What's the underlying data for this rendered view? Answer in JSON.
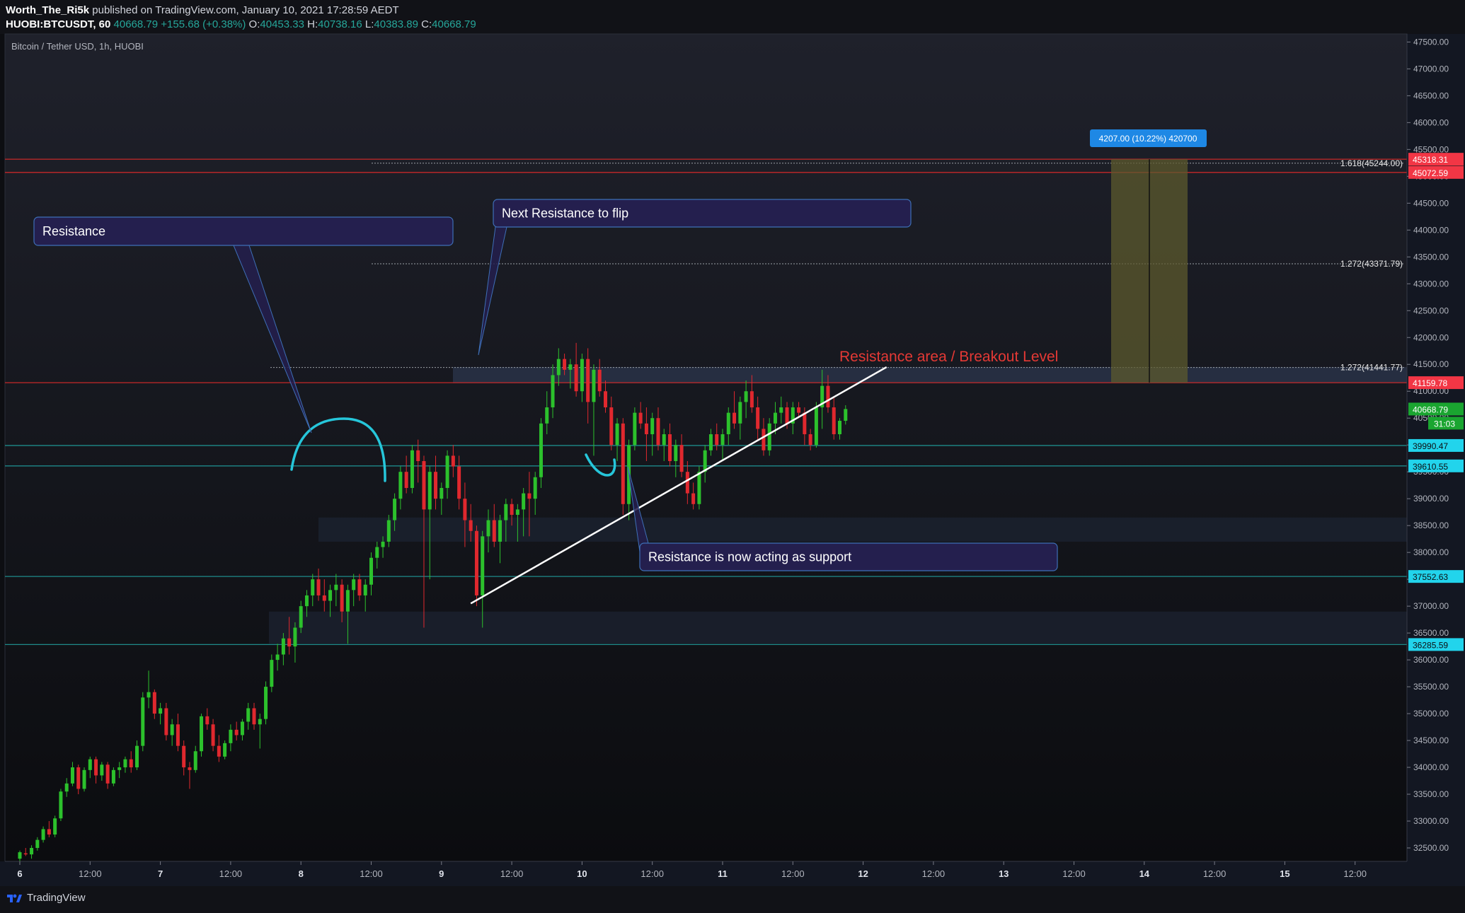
{
  "header": {
    "author": "Worth_The_Ri5k",
    "published": "published on TradingView.com, January 10, 2021 17:28:59 AEDT",
    "symbol": "HUOBI:BTCUSDT, 60",
    "last": "40668.79",
    "change": "+155.68 (+0.38%)",
    "open_label": "O:",
    "open": "40453.33",
    "high_label": "H:",
    "high": "40738.16",
    "low_label": "L:",
    "low": "40383.89",
    "close_label": "C:",
    "close": "40668.79"
  },
  "legend_title": "Bitcoin / Tether USD, 1h, HUOBI",
  "footer": {
    "brand": "TradingView"
  },
  "colors": {
    "up": "#26a69a",
    "up_body": "#2cc12c",
    "down": "#e0282e",
    "red_line": "#b71c1c",
    "cyan": "#26c6da",
    "teal_line": "#1e8a8a",
    "callout_bg": "#241f4e",
    "callout_border": "#3e6fb7",
    "projection_fill": "#5c5a2d",
    "price_green": "#1aa530",
    "price_red": "#f23645"
  },
  "chart_data": {
    "type": "candlestick",
    "title": "Bitcoin / Tether USD, 1h, HUOBI",
    "ylim": [
      32250,
      47650
    ],
    "y_ticks": [
      "32500.00",
      "33000.00",
      "33500.00",
      "34000.00",
      "34500.00",
      "35000.00",
      "35500.00",
      "36000.00",
      "36500.00",
      "37000.00",
      "37500.00",
      "38000.00",
      "38500.00",
      "39000.00",
      "39500.00",
      "40000.00",
      "40500.00",
      "41000.00",
      "41500.00",
      "42000.00",
      "42500.00",
      "43000.00",
      "43500.00",
      "44000.00",
      "44500.00",
      "45000.00",
      "45500.00",
      "46000.00",
      "46500.00",
      "47000.00",
      "47500.00"
    ],
    "x_ticks": [
      "6",
      "12:00",
      "7",
      "12:00",
      "8",
      "12:00",
      "9",
      "12:00",
      "10",
      "12:00",
      "11",
      "12:00",
      "12",
      "12:00",
      "13",
      "12:00",
      "14",
      "12:00",
      "15",
      "12:00"
    ],
    "candles": [
      [
        32300,
        32450,
        32250,
        32420
      ],
      [
        32400,
        32500,
        32350,
        32380
      ],
      [
        32380,
        32550,
        32300,
        32500
      ],
      [
        32500,
        32700,
        32450,
        32650
      ],
      [
        32650,
        32900,
        32600,
        32850
      ],
      [
        32850,
        33000,
        32700,
        32750
      ],
      [
        32750,
        33100,
        32700,
        33050
      ],
      [
        33050,
        33600,
        33000,
        33550
      ],
      [
        33550,
        33800,
        33450,
        33700
      ],
      [
        33700,
        34100,
        33650,
        34000
      ],
      [
        34000,
        34050,
        33500,
        33600
      ],
      [
        33600,
        34000,
        33550,
        33950
      ],
      [
        33950,
        34200,
        33800,
        34150
      ],
      [
        34150,
        34200,
        33700,
        33850
      ],
      [
        33850,
        34100,
        33750,
        34050
      ],
      [
        34050,
        34100,
        33600,
        33700
      ],
      [
        33700,
        34000,
        33650,
        33950
      ],
      [
        33950,
        34100,
        33800,
        34000
      ],
      [
        34000,
        34200,
        33900,
        34150
      ],
      [
        34150,
        34300,
        33900,
        34000
      ],
      [
        34000,
        34500,
        33950,
        34400
      ],
      [
        34400,
        35400,
        34300,
        35300
      ],
      [
        35300,
        35800,
        35100,
        35400
      ],
      [
        35400,
        35450,
        34900,
        35000
      ],
      [
        35000,
        35200,
        34800,
        35100
      ],
      [
        35100,
        35200,
        34500,
        34600
      ],
      [
        34600,
        34900,
        34400,
        34800
      ],
      [
        34800,
        35000,
        34300,
        34400
      ],
      [
        34400,
        34500,
        33850,
        34000
      ],
      [
        34000,
        34100,
        33600,
        33950
      ],
      [
        33950,
        34400,
        33900,
        34300
      ],
      [
        34300,
        35000,
        34200,
        34950
      ],
      [
        34950,
        35100,
        34700,
        34800
      ],
      [
        34800,
        34900,
        34300,
        34400
      ],
      [
        34400,
        34600,
        34100,
        34200
      ],
      [
        34200,
        34500,
        34150,
        34450
      ],
      [
        34450,
        34800,
        34300,
        34700
      ],
      [
        34700,
        34850,
        34500,
        34600
      ],
      [
        34600,
        34900,
        34500,
        34850
      ],
      [
        34850,
        35200,
        34700,
        35100
      ],
      [
        35100,
        35200,
        34700,
        34800
      ],
      [
        34800,
        35000,
        34350,
        34900
      ],
      [
        34900,
        35600,
        34800,
        35500
      ],
      [
        35500,
        36100,
        35400,
        36000
      ],
      [
        36000,
        36300,
        35800,
        36100
      ],
      [
        36100,
        36500,
        35900,
        36400
      ],
      [
        36400,
        36800,
        36100,
        36250
      ],
      [
        36250,
        36700,
        35950,
        36600
      ],
      [
        36600,
        37100,
        36500,
        37000
      ],
      [
        37000,
        37300,
        36800,
        37200
      ],
      [
        37200,
        37600,
        37000,
        37500
      ],
      [
        37500,
        37700,
        37100,
        37200
      ],
      [
        37200,
        37500,
        36900,
        37100
      ],
      [
        37100,
        37400,
        36800,
        37300
      ],
      [
        37300,
        37600,
        37000,
        37400
      ],
      [
        37400,
        37500,
        36700,
        36900
      ],
      [
        36900,
        37400,
        36300,
        37300
      ],
      [
        37300,
        37600,
        37000,
        37500
      ],
      [
        37500,
        37600,
        37100,
        37200
      ],
      [
        37200,
        37500,
        36900,
        37400
      ],
      [
        37400,
        38000,
        37200,
        37900
      ],
      [
        37900,
        38200,
        37700,
        38100
      ],
      [
        38100,
        38300,
        37900,
        38200
      ],
      [
        38200,
        38700,
        38100,
        38600
      ],
      [
        38600,
        39100,
        38400,
        39000
      ],
      [
        39000,
        39600,
        38800,
        39500
      ],
      [
        39500,
        39800,
        39100,
        39200
      ],
      [
        39200,
        40000,
        39100,
        39900
      ],
      [
        39900,
        40100,
        39300,
        39700
      ],
      [
        39700,
        39800,
        36600,
        38800
      ],
      [
        38800,
        39600,
        37500,
        39500
      ],
      [
        39500,
        39800,
        38800,
        39000
      ],
      [
        39000,
        39300,
        38700,
        39200
      ],
      [
        39200,
        39900,
        39000,
        39800
      ],
      [
        39800,
        40000,
        39400,
        39600
      ],
      [
        39600,
        39800,
        38800,
        39000
      ],
      [
        39000,
        39300,
        38100,
        38600
      ],
      [
        38600,
        38900,
        38200,
        38400
      ],
      [
        38400,
        38500,
        37000,
        37200
      ],
      [
        37200,
        38400,
        36600,
        38300
      ],
      [
        38300,
        38800,
        38000,
        38600
      ],
      [
        38600,
        38900,
        38100,
        38200
      ],
      [
        38200,
        38700,
        37800,
        38600
      ],
      [
        38600,
        39000,
        38200,
        38900
      ],
      [
        38900,
        39000,
        38500,
        38700
      ],
      [
        38700,
        38900,
        38200,
        38800
      ],
      [
        38800,
        39200,
        38300,
        39100
      ],
      [
        39100,
        39500,
        38300,
        39000
      ],
      [
        39000,
        39500,
        38700,
        39400
      ],
      [
        39400,
        40500,
        39200,
        40400
      ],
      [
        40400,
        41000,
        40200,
        40700
      ],
      [
        40700,
        41500,
        40500,
        41300
      ],
      [
        41300,
        41800,
        41100,
        41600
      ],
      [
        41600,
        41700,
        41300,
        41400
      ],
      [
        41400,
        41600,
        41050,
        41500
      ],
      [
        41500,
        41900,
        40900,
        41000
      ],
      [
        41000,
        41700,
        40800,
        41600
      ],
      [
        41600,
        41800,
        40400,
        40800
      ],
      [
        40800,
        41500,
        39800,
        41400
      ],
      [
        41400,
        41600,
        40900,
        41000
      ],
      [
        41000,
        41200,
        40600,
        40700
      ],
      [
        40700,
        40900,
        39900,
        40000
      ],
      [
        40000,
        40500,
        39700,
        40400
      ],
      [
        40400,
        40500,
        38700,
        38900
      ],
      [
        38900,
        40100,
        38600,
        40000
      ],
      [
        40000,
        40700,
        39900,
        40600
      ],
      [
        40600,
        40800,
        40300,
        40400
      ],
      [
        40400,
        40700,
        39700,
        40200
      ],
      [
        40200,
        40600,
        39800,
        40500
      ],
      [
        40500,
        40700,
        39900,
        40000
      ],
      [
        40000,
        40300,
        39700,
        40200
      ],
      [
        40200,
        40400,
        39600,
        39700
      ],
      [
        39700,
        40100,
        39400,
        40000
      ],
      [
        40000,
        40200,
        39400,
        39500
      ],
      [
        39500,
        39700,
        38900,
        39100
      ],
      [
        39100,
        39300,
        38800,
        38900
      ],
      [
        38900,
        39600,
        38800,
        39500
      ],
      [
        39500,
        40000,
        39300,
        39900
      ],
      [
        39900,
        40300,
        39800,
        40200
      ],
      [
        40200,
        40400,
        39900,
        40000
      ],
      [
        40000,
        40300,
        39700,
        40200
      ],
      [
        40200,
        40700,
        40000,
        40600
      ],
      [
        40600,
        41000,
        40300,
        40400
      ],
      [
        40400,
        40900,
        40100,
        40800
      ],
      [
        40800,
        41200,
        40500,
        41000
      ],
      [
        41000,
        41300,
        40600,
        40700
      ],
      [
        40700,
        40900,
        40100,
        40300
      ],
      [
        40300,
        40500,
        39800,
        39900
      ],
      [
        39900,
        40500,
        39800,
        40400
      ],
      [
        40400,
        40800,
        40200,
        40600
      ],
      [
        40600,
        40900,
        40400,
        40700
      ],
      [
        40700,
        40800,
        40300,
        40400
      ],
      [
        40400,
        40800,
        40200,
        40700
      ],
      [
        40700,
        40800,
        40500,
        40600
      ],
      [
        40600,
        40700,
        40000,
        40200
      ],
      [
        40200,
        40300,
        39900,
        40000
      ],
      [
        40000,
        40800,
        39950,
        40700
      ],
      [
        40700,
        41400,
        40300,
        41100
      ],
      [
        41100,
        41300,
        40600,
        40700
      ],
      [
        40700,
        40900,
        40100,
        40200
      ],
      [
        40200,
        40500,
        40100,
        40450
      ],
      [
        40450,
        40740,
        40380,
        40669
      ]
    ],
    "horizontal_levels": [
      {
        "price": 45318.31,
        "label": "45318.31",
        "style": "red"
      },
      {
        "price": 45072.59,
        "label": "45072.59",
        "style": "red"
      },
      {
        "price": 41159.78,
        "label": "41159.78",
        "style": "red"
      },
      {
        "price": 39990.47,
        "label": "39990.47",
        "style": "cyan"
      },
      {
        "price": 39610.55,
        "label": "39610.55",
        "style": "cyan"
      },
      {
        "price": 37552.63,
        "label": "37552.63",
        "style": "cyan"
      },
      {
        "price": 36285.59,
        "label": "36285.59",
        "style": "cyan"
      }
    ],
    "fib_levels": [
      {
        "price": 45244.0,
        "label": "1.618(45244.00)"
      },
      {
        "price": 43371.79,
        "label": "1.272(43371.79)"
      },
      {
        "price": 41441.77,
        "label": "1.272(41441.77)"
      }
    ],
    "current_price": {
      "label": "40668.79",
      "countdown": "31:03"
    },
    "projection": {
      "from": 41159.78,
      "to": 45318.31,
      "label": "4207.00 (10.22%) 420700"
    },
    "trendline": {
      "from": [
        77,
        37050
      ],
      "to": [
        148,
        41450
      ]
    },
    "zones": [
      {
        "from": 38200,
        "to": 38650
      },
      {
        "from": 36300,
        "to": 36900
      },
      {
        "from": 41150,
        "to": 41450
      }
    ],
    "annotations": {
      "resistance": "Resistance",
      "next_resistance": "Next Resistance to flip",
      "breakout": "Resistance area / Breakout Level",
      "support": "Resistance is now acting as support"
    }
  }
}
